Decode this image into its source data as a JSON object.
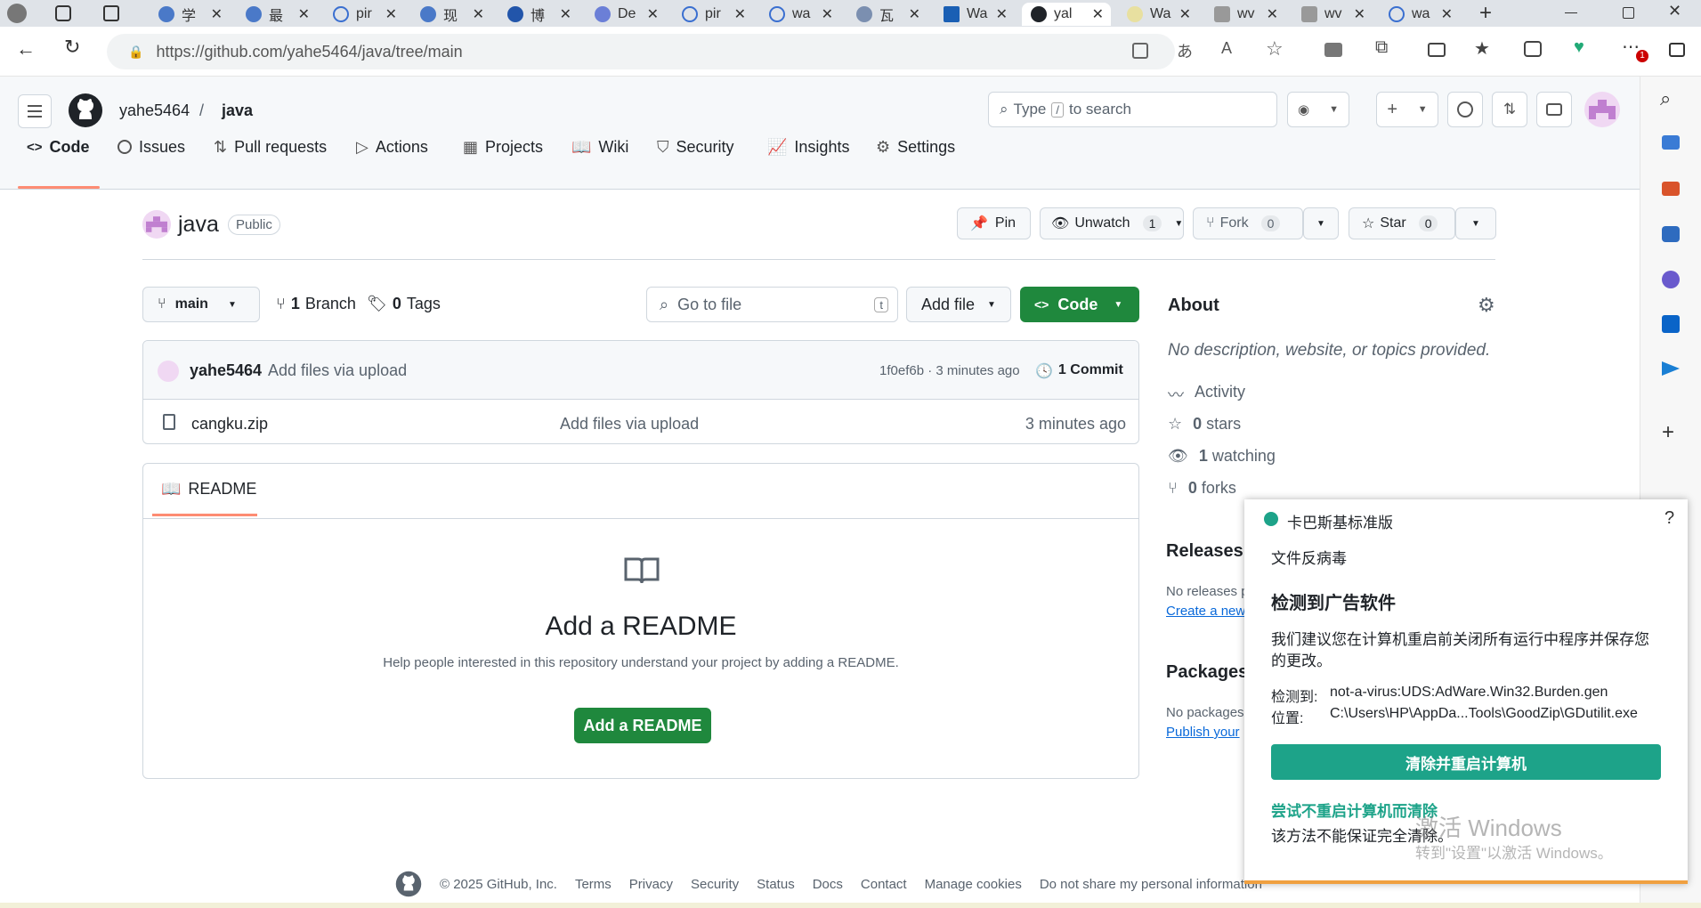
{
  "browser": {
    "tabs": [
      {
        "label": "学"
      },
      {
        "label": "最"
      },
      {
        "label": "pir"
      },
      {
        "label": "现"
      },
      {
        "label": "博"
      },
      {
        "label": "De"
      },
      {
        "label": "pir"
      },
      {
        "label": "wa"
      },
      {
        "label": "瓦"
      },
      {
        "label": "Wa"
      },
      {
        "label": "yal"
      },
      {
        "label": "Wa"
      },
      {
        "label": "wv"
      },
      {
        "label": "wv"
      },
      {
        "label": "wa"
      }
    ],
    "url": "https://github.com/yahe5464/java/tree/main",
    "notification_badge": "1"
  },
  "github": {
    "owner": "yahe5464",
    "separator": "/",
    "repo": "java",
    "search_placeholder_pre": "Type",
    "search_key": "/",
    "search_placeholder_post": "to search",
    "nav": [
      "Code",
      "Issues",
      "Pull requests",
      "Actions",
      "Projects",
      "Wiki",
      "Security",
      "Insights",
      "Settings"
    ],
    "repo_title": "java",
    "visibility": "Public",
    "pin_label": "Pin",
    "unwatch_label": "Unwatch",
    "unwatch_count": "1",
    "fork_label": "Fork",
    "fork_count": "0",
    "star_label": "Star",
    "star_count": "0",
    "branch_label": "main",
    "branches_count": "1",
    "branches_word": "Branch",
    "tags_count": "0",
    "tags_word": "Tags",
    "goto_placeholder": "Go to file",
    "goto_key": "t",
    "add_file_label": "Add file",
    "code_label": "Code",
    "commit": {
      "author": "yahe5464",
      "message": "Add files via upload",
      "hash": "1f0ef6b",
      "sep": " · ",
      "time": "3 minutes ago",
      "count_label": "1 Commit"
    },
    "files": [
      {
        "name": "cangku.zip",
        "message": "Add files via upload",
        "time": "3 minutes ago"
      }
    ],
    "readme_tab": "README",
    "readme_heading": "Add a README",
    "readme_desc": "Help people interested in this repository understand your project by adding a README.",
    "readme_button": "Add a README",
    "about": {
      "title": "About",
      "desc": "No description, website, or topics provided.",
      "activity": "Activity",
      "stars_count": "0",
      "stars_word": "stars",
      "watching_count": "1",
      "watching_word": "watching",
      "forks_count": "0",
      "forks_word": "forks"
    },
    "releases": {
      "title": "Releases",
      "none": "No releases p",
      "link": "Create a new"
    },
    "packages": {
      "title": "Packages",
      "none": "No packages",
      "link": "Publish your"
    },
    "footer": [
      "© 2025 GitHub, Inc.",
      "Terms",
      "Privacy",
      "Security",
      "Status",
      "Docs",
      "Contact",
      "Manage cookies",
      "Do not share my personal information"
    ]
  },
  "popup": {
    "app": "卡巴斯基标准版",
    "help": "?",
    "section": "文件反病毒",
    "headline": "检测到广告软件",
    "advice": "我们建议您在计算机重启前关闭所有运行中程序并保存您的更改。",
    "detected_label": "检测到:",
    "detected_value": "not-a-virus:UDS:AdWare.Win32.Burden.gen",
    "location_label": "位置:",
    "location_value": "C:\\Users\\HP\\AppDa...Tools\\GoodZip\\GDutilit.exe",
    "primary_button": "清除并重启计算机",
    "secondary_link": "尝试不重启计算机而清除",
    "secondary_note": "该方法不能保证完全清除。"
  },
  "watermark": {
    "line1": "激活 Windows",
    "line2": "转到\"设置\"以激活 Windows。"
  },
  "colors": {
    "green": "#1f883d",
    "kaspersky": "#1da389",
    "link": "#0969da"
  }
}
